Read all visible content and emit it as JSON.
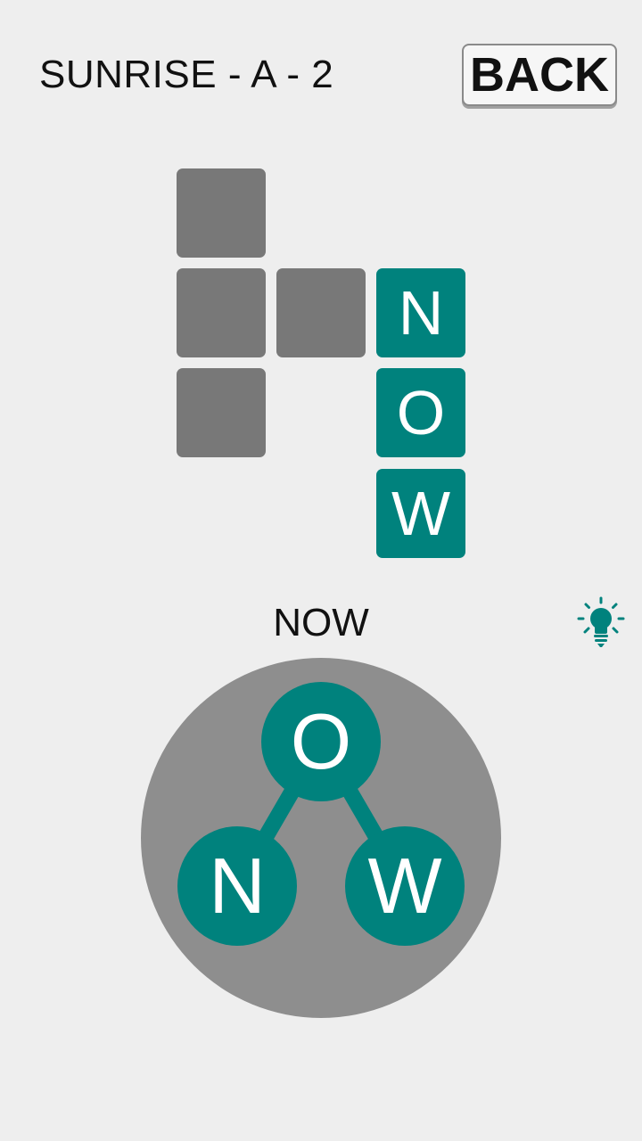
{
  "header": {
    "level_title": "SUNRISE - A - 2",
    "back_label": "BACK"
  },
  "grid": {
    "cells": [
      {
        "row": 0,
        "col": 0,
        "letter": ""
      },
      {
        "row": 1,
        "col": 0,
        "letter": ""
      },
      {
        "row": 1,
        "col": 1,
        "letter": ""
      },
      {
        "row": 1,
        "col": 2,
        "letter": "N"
      },
      {
        "row": 2,
        "col": 0,
        "letter": ""
      },
      {
        "row": 2,
        "col": 2,
        "letter": "O"
      },
      {
        "row": 3,
        "col": 2,
        "letter": "W"
      }
    ]
  },
  "current_word": "NOW",
  "hint": {
    "icon": "lightbulb-icon"
  },
  "wheel": {
    "letters": [
      {
        "letter": "O",
        "position": "top"
      },
      {
        "letter": "N",
        "position": "bottom-left"
      },
      {
        "letter": "W",
        "position": "bottom-right"
      }
    ]
  },
  "colors": {
    "accent": "#00827d",
    "empty_cell": "#787878",
    "wheel": "#8e8e8e",
    "background": "#eeeeee"
  }
}
